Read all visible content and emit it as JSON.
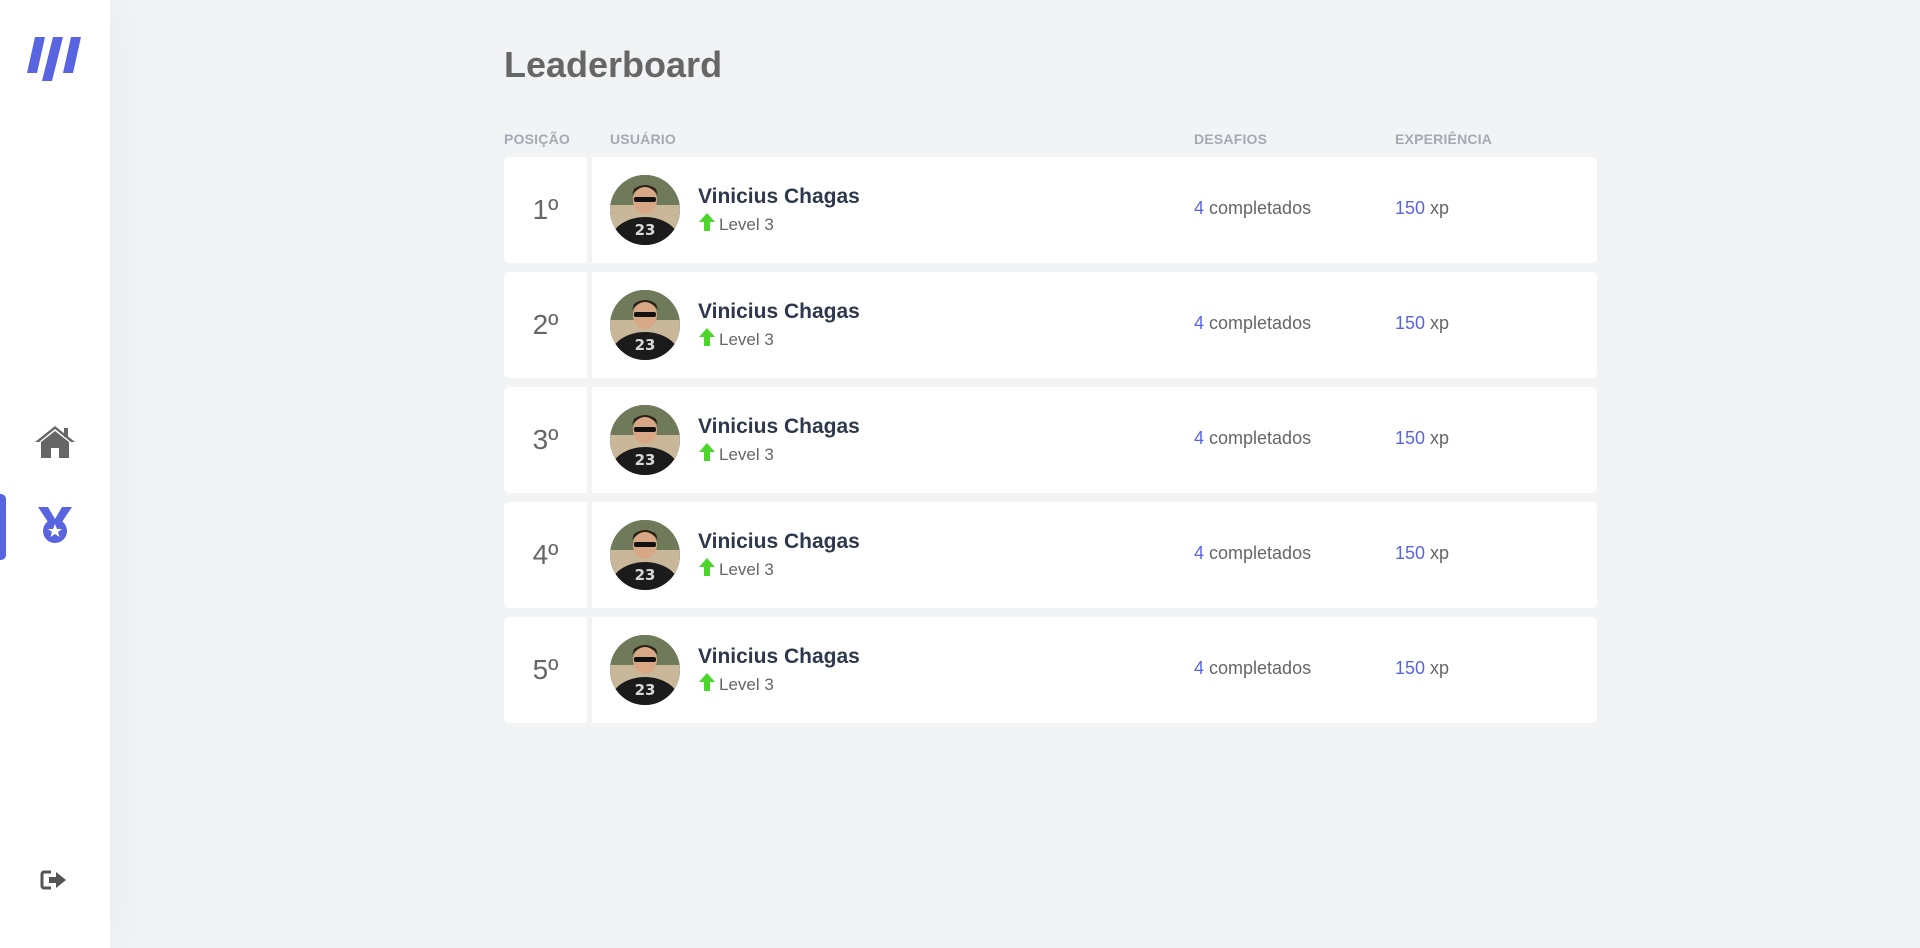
{
  "colors": {
    "accent": "#5965e0",
    "level_up": "#4cd62b",
    "text": "#666666",
    "title": "#2e384d",
    "header": "#a7a8b3",
    "background": "#f2f3f5"
  },
  "sidebar": {
    "logo_icon": "logo-icon",
    "nav": [
      {
        "icon": "home-icon",
        "active": false
      },
      {
        "icon": "medal-icon",
        "active": true
      }
    ],
    "logout_icon": "logout-icon"
  },
  "page": {
    "title": "Leaderboard"
  },
  "table": {
    "headers": {
      "position": "Posição",
      "user": "Usuário",
      "challenges": "Desafios",
      "experience": "Experiência"
    },
    "rows": [
      {
        "position": "1º",
        "name": "Vinicius Chagas",
        "level": "Level 3",
        "challenges": "4",
        "challenges_suffix": " completados",
        "xp": "150",
        "xp_suffix": " xp"
      },
      {
        "position": "2º",
        "name": "Vinicius Chagas",
        "level": "Level 3",
        "challenges": "4",
        "challenges_suffix": " completados",
        "xp": "150",
        "xp_suffix": " xp"
      },
      {
        "position": "3º",
        "name": "Vinicius Chagas",
        "level": "Level 3",
        "challenges": "4",
        "challenges_suffix": " completados",
        "xp": "150",
        "xp_suffix": " xp"
      },
      {
        "position": "4º",
        "name": "Vinicius Chagas",
        "level": "Level 3",
        "challenges": "4",
        "challenges_suffix": " completados",
        "xp": "150",
        "xp_suffix": " xp"
      },
      {
        "position": "5º",
        "name": "Vinicius Chagas",
        "level": "Level 3",
        "challenges": "4",
        "challenges_suffix": " completados",
        "xp": "150",
        "xp_suffix": " xp"
      }
    ]
  }
}
